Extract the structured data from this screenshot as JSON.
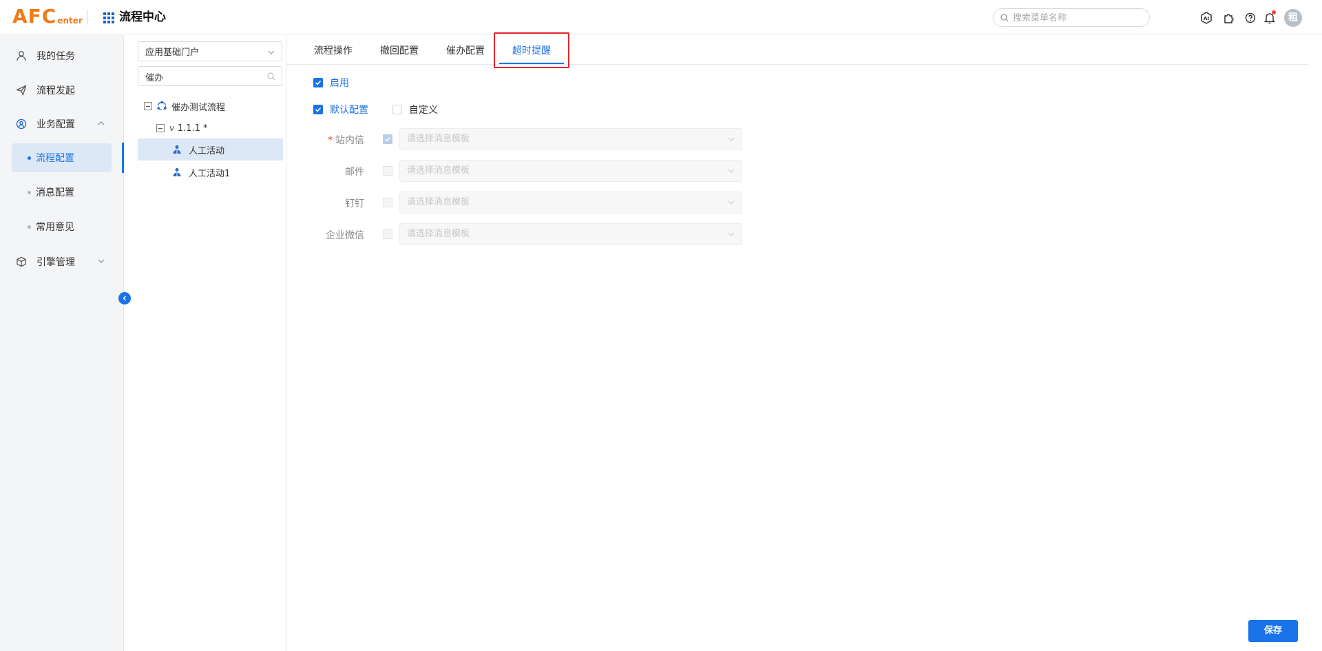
{
  "header": {
    "logo_big": "AFC",
    "logo_small": "enter",
    "app_title": "流程中心",
    "search_placeholder": "搜索菜单名称",
    "avatar_text": "租"
  },
  "sidebar": {
    "items": [
      {
        "label": "我的任务",
        "icon": "user-icon"
      },
      {
        "label": "流程发起",
        "icon": "send-icon"
      },
      {
        "label": "业务配置",
        "icon": "settings-circle-icon",
        "expanded": true
      },
      {
        "label": "引擎管理",
        "icon": "cube-icon",
        "expanded": false
      }
    ],
    "sub_items": [
      {
        "label": "流程配置",
        "active": true
      },
      {
        "label": "消息配置",
        "active": false
      },
      {
        "label": "常用意见",
        "active": false
      }
    ]
  },
  "tree_panel": {
    "portal_select": "应用基础门户",
    "filter_value": "催办",
    "nodes": [
      {
        "label": "催办测试流程",
        "level": 0
      },
      {
        "label": "1.1.1 *",
        "level": 1,
        "prefix": "v"
      },
      {
        "label": "人工活动",
        "level": 2,
        "selected": true
      },
      {
        "label": "人工活动1",
        "level": 2,
        "selected": false
      }
    ]
  },
  "main": {
    "tabs": [
      {
        "label": "流程操作",
        "active": false
      },
      {
        "label": "撤回配置",
        "active": false
      },
      {
        "label": "催办配置",
        "active": false
      },
      {
        "label": "超时提醒",
        "active": true
      }
    ],
    "enable_label": "启用",
    "enable_checked": true,
    "default_config_label": "默认配置",
    "default_config_checked": true,
    "custom_label": "自定义",
    "custom_checked": false,
    "channels": [
      {
        "label": "站内信",
        "required": true,
        "checked": true,
        "placeholder": "请选择消息模板"
      },
      {
        "label": "邮件",
        "required": false,
        "checked": false,
        "placeholder": "请选择消息模板"
      },
      {
        "label": "钉钉",
        "required": false,
        "checked": false,
        "placeholder": "请选择消息模板"
      },
      {
        "label": "企业微信",
        "required": false,
        "checked": false,
        "placeholder": "请选择消息模板"
      }
    ],
    "save_label": "保存"
  },
  "colors": {
    "accent": "#1a73e8",
    "logo": "#f07a1a",
    "highlight": "#e0262b",
    "selected_bg": "#dde8f6"
  }
}
